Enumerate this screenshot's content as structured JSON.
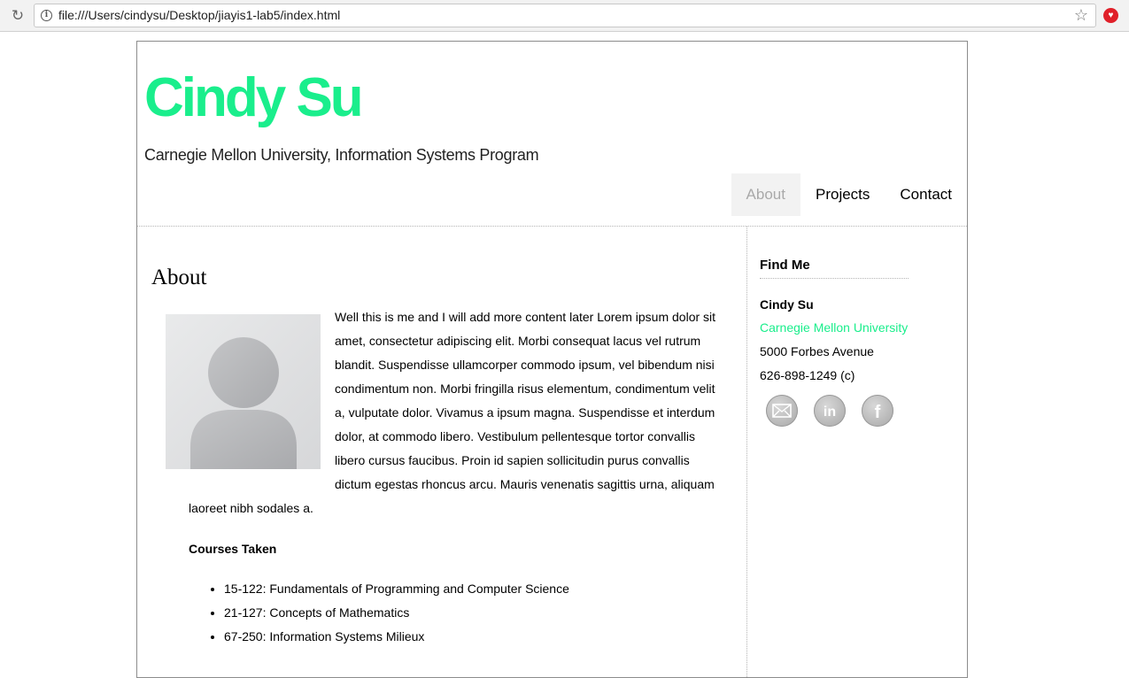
{
  "browser": {
    "url": "file:///Users/cindysu/Desktop/jiayis1-lab5/index.html"
  },
  "header": {
    "title": "Cindy Su",
    "subtitle": "Carnegie Mellon University, Information Systems Program"
  },
  "nav": {
    "items": [
      {
        "label": "About",
        "active": true
      },
      {
        "label": "Projects",
        "active": false
      },
      {
        "label": "Contact",
        "active": false
      }
    ]
  },
  "about": {
    "heading": "About",
    "body": "Well this is me and I will add more content later Lorem ipsum dolor sit amet, consectetur adipiscing elit. Morbi consequat lacus vel rutrum blandit. Suspendisse ullamcorper commodo ipsum, vel bibendum nisi condimentum non. Morbi fringilla risus elementum, condimentum velit a, vulputate dolor. Vivamus a ipsum magna. Suspendisse et interdum dolor, at commodo libero. Vestibulum pellentesque tortor convallis libero cursus faucibus. Proin id sapien sollicitudin purus convallis dictum egestas rhoncus arcu. Mauris venenatis sagittis urna, aliquam laoreet nibh sodales a.",
    "courses_heading": "Courses Taken",
    "courses": [
      "15-122: Fundamentals of Programming and Computer Science",
      "21-127: Concepts of Mathematics",
      "67-250: Information Systems Milieux"
    ]
  },
  "sidebar": {
    "heading": "Find Me",
    "name": "Cindy Su",
    "university": "Carnegie Mellon University",
    "address": "5000 Forbes Avenue",
    "phone": "626-898-1249 (c)",
    "social": [
      "email-icon",
      "linkedin-icon",
      "facebook-icon"
    ]
  },
  "colors": {
    "accent": "#1aee8c",
    "nav_active_bg": "#f2f2f2",
    "nav_active_text": "#a9a9a9"
  }
}
